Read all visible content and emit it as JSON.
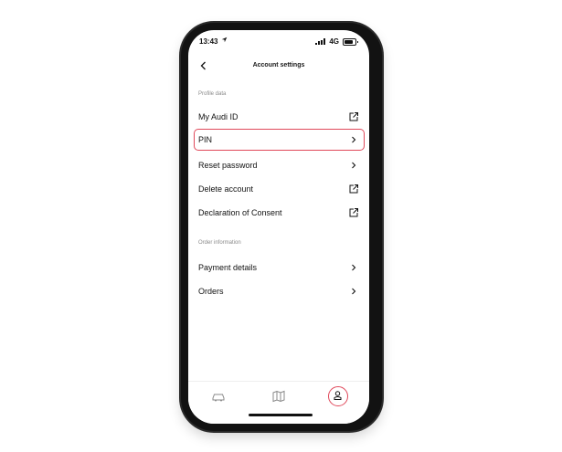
{
  "status_bar": {
    "time": "13:43",
    "network": "4G"
  },
  "header": {
    "title": "Account settings"
  },
  "sections": [
    {
      "label": "Profile data",
      "items": [
        {
          "label": "My Audi ID",
          "icon": "external-link-icon"
        },
        {
          "label": "PIN",
          "icon": "chevron-right-icon",
          "highlighted": true
        },
        {
          "label": "Reset password",
          "icon": "chevron-right-icon"
        },
        {
          "label": "Delete account",
          "icon": "external-link-icon"
        },
        {
          "label": "Declaration of Consent",
          "icon": "external-link-icon"
        }
      ]
    },
    {
      "label": "Order information",
      "items": [
        {
          "label": "Payment details",
          "icon": "chevron-right-icon"
        },
        {
          "label": "Orders",
          "icon": "chevron-right-icon"
        }
      ]
    }
  ],
  "tab_bar": {
    "tabs": [
      {
        "icon": "car-icon"
      },
      {
        "icon": "map-icon"
      },
      {
        "icon": "profile-icon",
        "active": true
      }
    ]
  },
  "colors": {
    "highlight": "#e0485a",
    "section_label": "#8a8a8a",
    "text": "#111111"
  }
}
